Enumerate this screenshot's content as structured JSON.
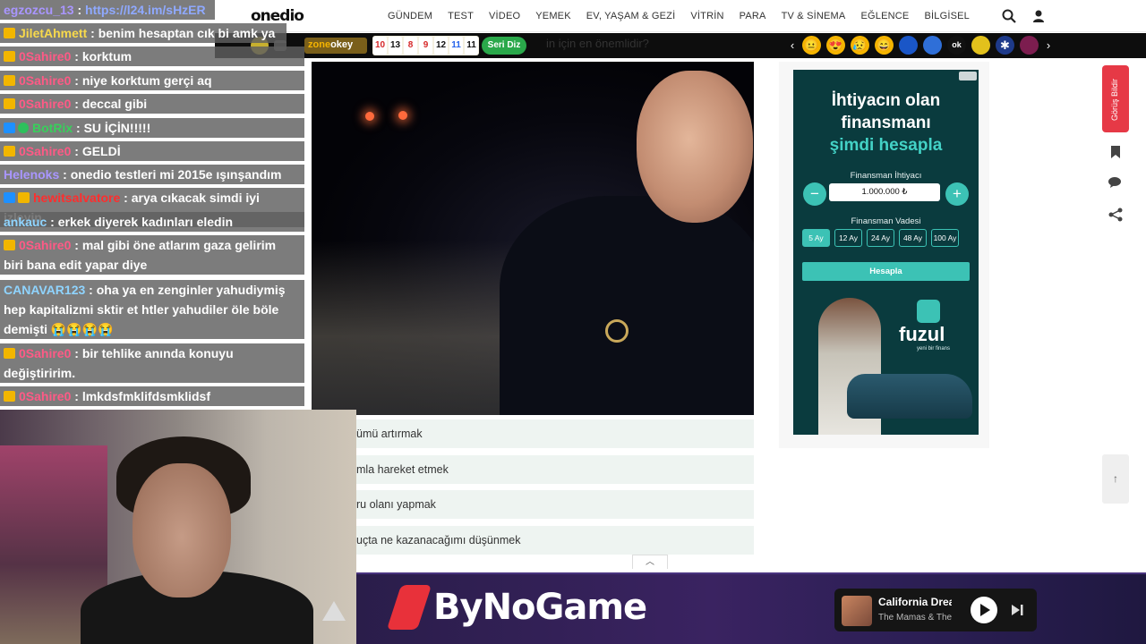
{
  "site": {
    "logo": "onedio",
    "nav": [
      "GÜNDEM",
      "TEST",
      "VİDEO",
      "YEMEK",
      "EV, YAŞAM & GEZİ",
      "VİTRİN",
      "PARA",
      "TV & SİNEMA",
      "EĞLENCE",
      "BİLGİSEL"
    ],
    "question_partial": "in için en önemlidir?",
    "answers": [
      "ümü artırmak",
      "mla hareket etmek",
      "ru olanı yapmak",
      "uçta ne kazanacağımı düşünmek"
    ],
    "feedback_tab": "Görüş Bildir",
    "scroll_top": "↑"
  },
  "game_bar": {
    "brand_a": "zone",
    "brand_b": "okey",
    "tiles": [
      {
        "n": "10",
        "color": "#d62828"
      },
      {
        "n": "13",
        "color": "#111111"
      },
      {
        "n": "8",
        "color": "#d62828"
      },
      {
        "n": "9",
        "color": "#d62828"
      },
      {
        "n": "12",
        "color": "#111111"
      },
      {
        "n": "11",
        "color": "#2563eb"
      },
      {
        "n": "11",
        "color": "#111111"
      }
    ],
    "button": "Seri Diz",
    "reactions": [
      {
        "icon": "emoji-icon",
        "color": "#f4b400",
        "glyph": "😐"
      },
      {
        "icon": "heart-eyes-icon",
        "color": "#f4b400",
        "glyph": "😍"
      },
      {
        "icon": "sad-icon",
        "color": "#f4b400",
        "glyph": "😥"
      },
      {
        "icon": "laugh-icon",
        "color": "#f4b400",
        "glyph": "😄"
      },
      {
        "icon": "brand-icon",
        "color": "#1a56c7",
        "glyph": ""
      },
      {
        "icon": "brand-icon",
        "color": "#2f6fd8",
        "glyph": ""
      },
      {
        "icon": "ok-icon",
        "color": "#111111",
        "glyph": "ok"
      },
      {
        "icon": "emoji-icon",
        "color": "#e2c11c",
        "glyph": ""
      },
      {
        "icon": "flag-icon",
        "color": "#1e3a8a",
        "glyph": "✱"
      },
      {
        "icon": "team-icon",
        "color": "#7c1d4f",
        "glyph": ""
      }
    ]
  },
  "ad": {
    "headline_1": "İhtiyacın olan",
    "headline_2": "finansmanı",
    "headline_3": "şimdi hesapla",
    "need_label": "Finansman İhtiyacı",
    "amount": "1.000.000 ₺",
    "term_label": "Finansman Vadesi",
    "terms": [
      "5 Ay",
      "12 Ay",
      "24 Ay",
      "48 Ay",
      "100 Ay"
    ],
    "active_term": "5 Ay",
    "cta": "Hesapla",
    "brand": "fuzul",
    "tagline": "yeni bir finans"
  },
  "chat": [
    {
      "user": "egzozcu_13",
      "ucolor": "u-purple",
      "msg": "https://l24.im/sHzER",
      "link": true,
      "badge": false
    },
    {
      "user": "JiletAhmett",
      "ucolor": "u-yellow",
      "msg": "benim hesaptan cık bi amk ya",
      "badge": true
    },
    {
      "user": "0Sahire0",
      "ucolor": "u-pink",
      "msg": "korktum",
      "badge": true
    },
    {
      "user": "0Sahire0",
      "ucolor": "u-pink",
      "msg": "niye korktum gerçi aq",
      "badge": true
    },
    {
      "user": "0Sahire0",
      "ucolor": "u-pink",
      "msg": "deccal gibi",
      "badge": true
    },
    {
      "user": "BotRix",
      "ucolor": "u-green",
      "msg": "SU İÇİN!!!!!",
      "badge": false,
      "bot": true
    },
    {
      "user": "0Sahire0",
      "ucolor": "u-pink",
      "msg": "GELDİ",
      "badge": true
    },
    {
      "user": "Helenoks",
      "ucolor": "u-purple",
      "msg": "onedio testleri mi 2015e ışınşandım",
      "badge": false
    },
    {
      "user": "hewitsalvatore",
      "ucolor": "u-red",
      "msg": "arya cıkacak simdi iyi izleyin",
      "badge": true,
      "double": true
    },
    {
      "user": "ankauc",
      "ucolor": "u-cyan",
      "msg": "erkek diyerek kadınları eledin",
      "badge": false
    },
    {
      "user": "0Sahire0",
      "ucolor": "u-pink",
      "msg": "mal gibi öne atlarım gaza gelirim",
      "msg2": "biri bana edit yapar diye",
      "badge": true
    },
    {
      "user": "CANAVAR123",
      "ucolor": "u-cyan",
      "msg": "oha ya en zenginler yahudiymiş",
      "msg2": "hep kapitalizmi sktir et htler yahudiler öle böle",
      "msg3": "demişti 😭😭😭😭",
      "badge": false
    },
    {
      "user": "0Sahire0",
      "ucolor": "u-pink",
      "msg": "bir tehlike anında konuyu",
      "msg2": "değiştiririm.",
      "badge": true
    },
    {
      "user": "0Sahire0",
      "ucolor": "u-pink",
      "msg": "lmkdsfmklifdsmklidsf",
      "badge": true
    }
  ],
  "banner": {
    "brand": "ByNoGame",
    "song": "California Dreamin'",
    "artist": "The Mamas & The Papas"
  }
}
